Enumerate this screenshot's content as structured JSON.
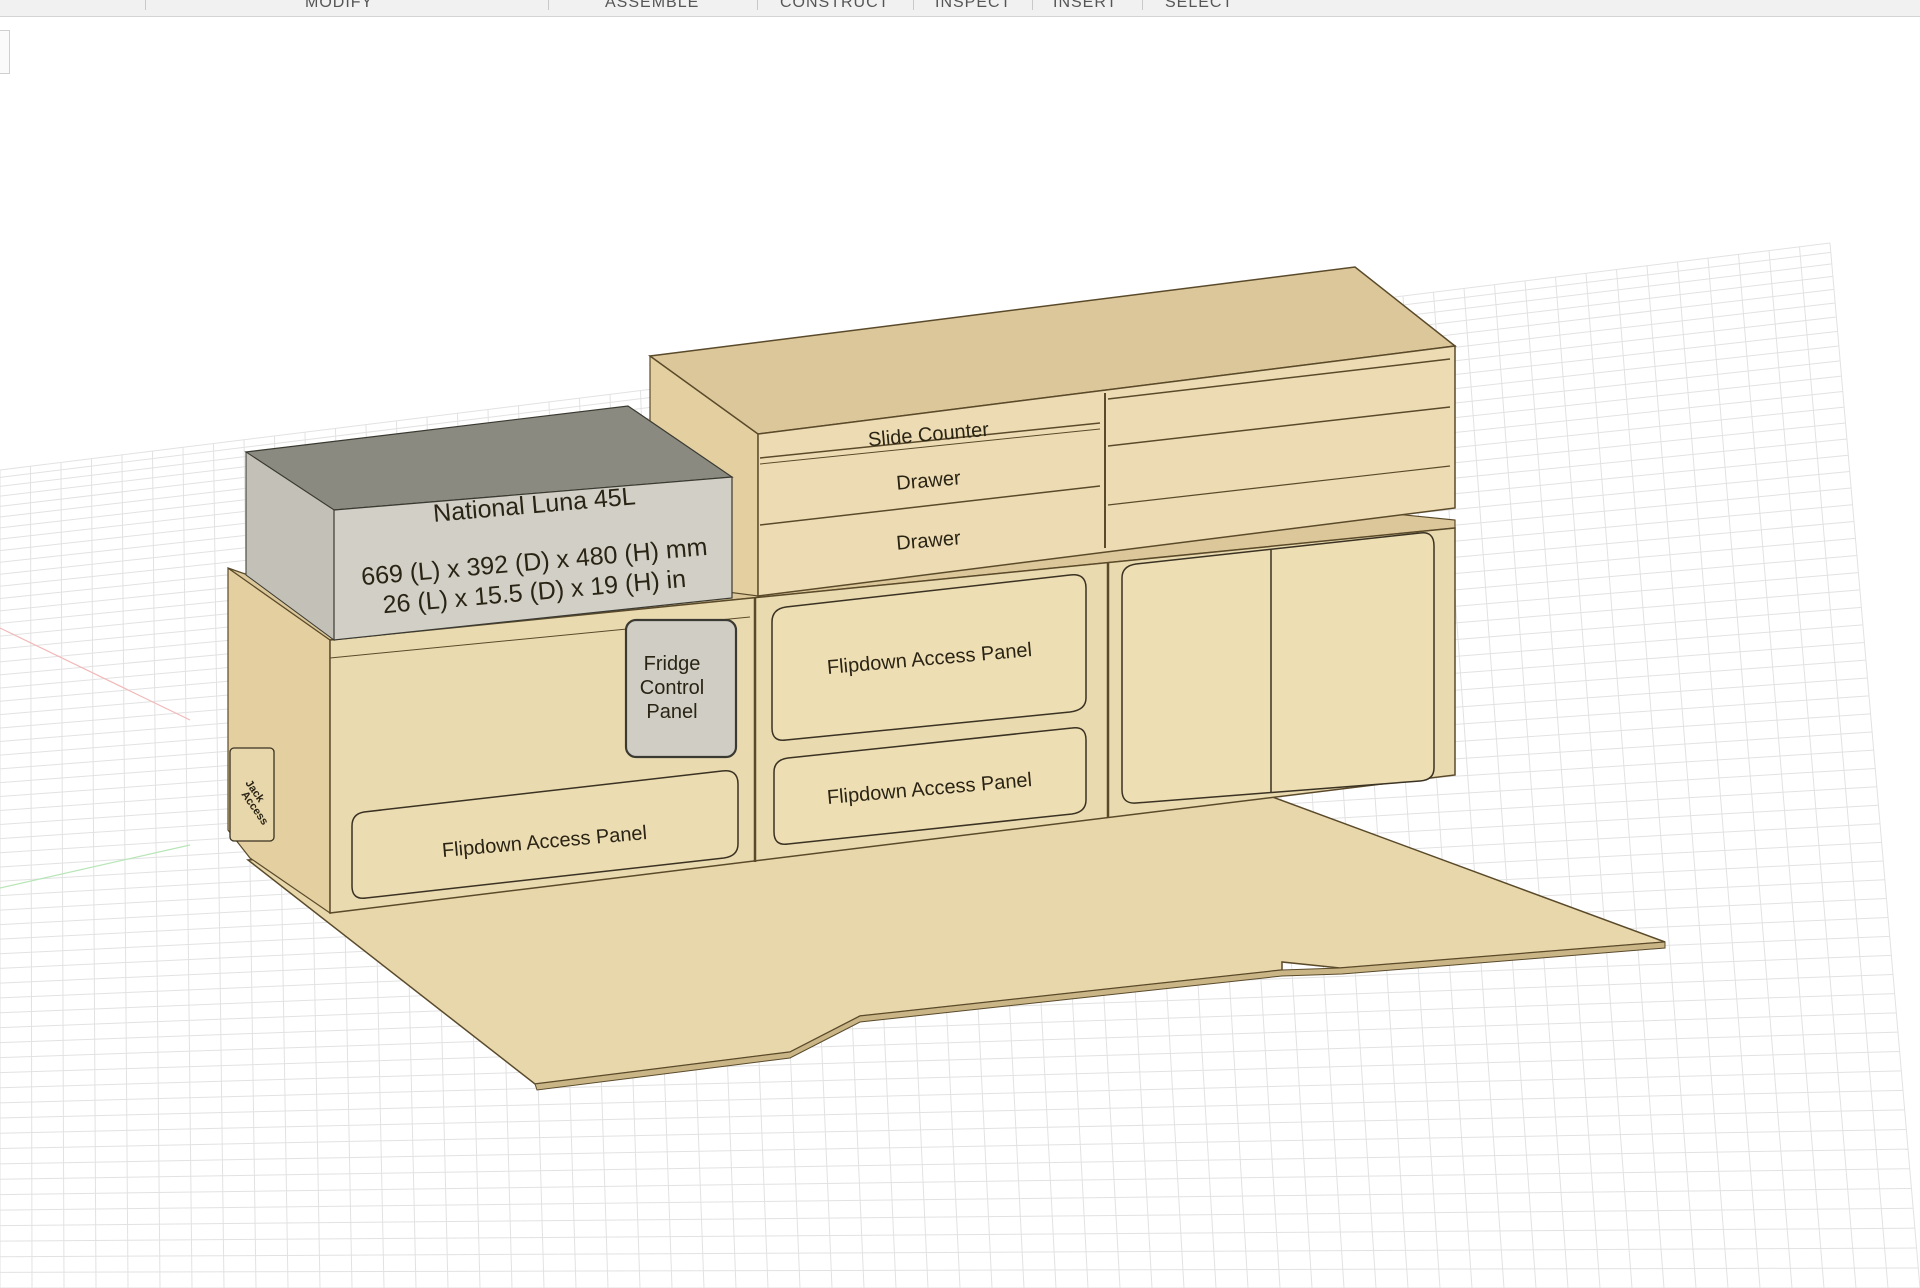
{
  "toolbar": {
    "tabs": [
      {
        "id": "modify",
        "label": "MODIFY"
      },
      {
        "id": "assemble",
        "label": "ASSEMBLE"
      },
      {
        "id": "construct",
        "label": "CONSTRUCT"
      },
      {
        "id": "inspect",
        "label": "INSPECT"
      },
      {
        "id": "insert",
        "label": "INSERT"
      },
      {
        "id": "select",
        "label": "SELECT"
      }
    ]
  },
  "model": {
    "fridge": {
      "title": "National Luna 45L",
      "dims_mm": "669 (L) x  392 (D) x 480 (H) mm",
      "dims_in": "26 (L) x 15.5 (D) x 19 (H) in"
    },
    "fridge_control": [
      "Fridge",
      "Control",
      "Panel"
    ],
    "slide_counter": "Slide Counter",
    "drawer_top": "Drawer",
    "drawer_bottom": "Drawer",
    "flipdown_center_top": "Flipdown Access Panel",
    "flipdown_center_bottom": "Flipdown Access Panel",
    "flipdown_left": "Flipdown Access Panel",
    "jack_access": [
      "Jack",
      "Access"
    ]
  },
  "colors": {
    "wood": "#e6d3a6",
    "wood_light": "#eddcb3",
    "wood_top": "#dcc79a",
    "fridge_front": "#cfcdc4",
    "fridge_top": "#8a8a80",
    "grid_line": "#e2e2e2",
    "axis_red": "#f2b8b8",
    "axis_green": "#b8e6b8"
  }
}
